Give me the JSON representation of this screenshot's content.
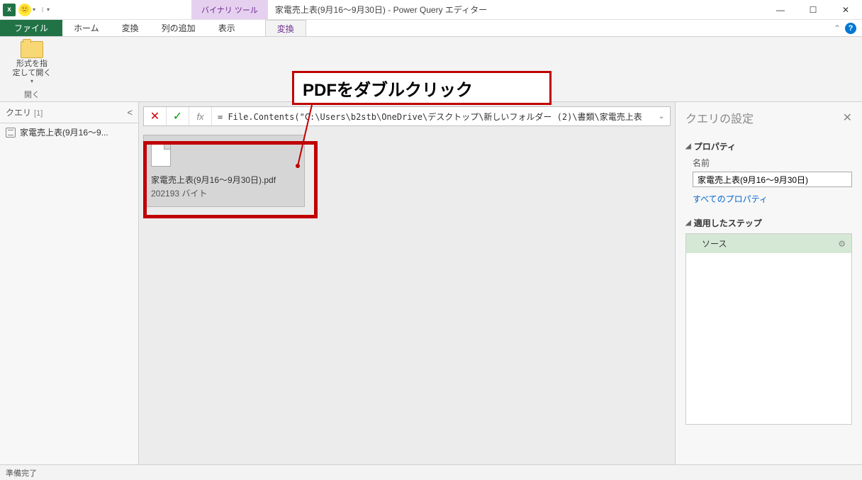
{
  "titlebar": {
    "context_tool_label": "バイナリ ツール",
    "title": "家電売上表(9月16～9月30日) - Power Query エディター"
  },
  "tabs": {
    "file": "ファイル",
    "home": "ホーム",
    "transform": "変換",
    "add_column": "列の追加",
    "view": "表示",
    "context_transform": "変換"
  },
  "ribbon": {
    "open_as": "形式を指\n定して開く",
    "open_group": "開く"
  },
  "queries": {
    "title": "クエリ",
    "count": "[1]",
    "items": [
      "家電売上表(9月16～9..."
    ]
  },
  "formula": {
    "text": "= File.Contents(\"C:\\Users\\b2stb\\OneDrive\\デスクトップ\\新しいフォルダー (2)\\書類\\家電売上表"
  },
  "file_card": {
    "name": "家電売上表(9月16～9月30日).pdf",
    "size": "202193 バイト"
  },
  "annotation": {
    "text": "PDFをダブルクリック"
  },
  "settings": {
    "title": "クエリの設定",
    "properties_section": "プロパティ",
    "name_label": "名前",
    "name_value": "家電売上表(9月16～9月30日)",
    "all_properties": "すべてのプロパティ",
    "steps_section": "適用したステップ",
    "steps": [
      "ソース"
    ]
  },
  "statusbar": {
    "text": "準備完了"
  }
}
